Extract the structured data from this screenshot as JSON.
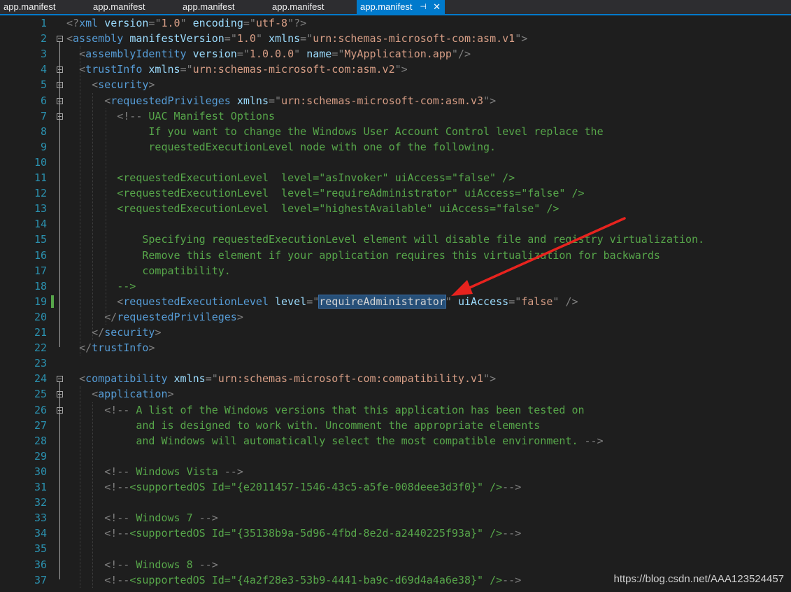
{
  "tabs": [
    {
      "label": "app.manifest",
      "active": false
    },
    {
      "label": "app.manifest",
      "active": false
    },
    {
      "label": "app.manifest",
      "active": false
    },
    {
      "label": "app.manifest",
      "active": false
    },
    {
      "label": "app.manifest",
      "active": true,
      "pin_icon": "pin-icon",
      "close_icon": "close-icon"
    }
  ],
  "colors": {
    "background": "#1e1e1e",
    "line_number": "#2b91af",
    "element": "#569cd6",
    "attribute": "#9cdcfe",
    "value": "#d69d85",
    "comment": "#57a64a",
    "active_tab": "#007acc",
    "selection": "#264f78",
    "arrow": "#e8231e"
  },
  "editor": {
    "selected_text": "requireAdministrator",
    "modified_line": 19,
    "lines": [
      {
        "n": "1",
        "fold": false,
        "tokens": [
          [
            "b",
            "<?"
          ],
          [
            "e",
            "xml"
          ],
          [
            "p",
            " "
          ],
          [
            "a",
            "version"
          ],
          [
            "b",
            "="
          ],
          [
            "b",
            "\""
          ],
          [
            "v",
            "1.0"
          ],
          [
            "b",
            "\""
          ],
          [
            "p",
            " "
          ],
          [
            "a",
            "encoding"
          ],
          [
            "b",
            "="
          ],
          [
            "b",
            "\""
          ],
          [
            "v",
            "utf-8"
          ],
          [
            "b",
            "\""
          ],
          [
            "b",
            "?>"
          ]
        ]
      },
      {
        "n": "2",
        "fold": true,
        "tokens": [
          [
            "b",
            "<"
          ],
          [
            "e",
            "assembly"
          ],
          [
            "p",
            " "
          ],
          [
            "a",
            "manifestVersion"
          ],
          [
            "b",
            "="
          ],
          [
            "b",
            "\""
          ],
          [
            "v",
            "1.0"
          ],
          [
            "b",
            "\""
          ],
          [
            "p",
            " "
          ],
          [
            "a",
            "xmlns"
          ],
          [
            "b",
            "="
          ],
          [
            "b",
            "\""
          ],
          [
            "v",
            "urn:schemas-microsoft-com:asm.v1"
          ],
          [
            "b",
            "\""
          ],
          [
            "b",
            ">"
          ]
        ]
      },
      {
        "n": "3",
        "fold": false,
        "tokens": [
          [
            "p",
            "  "
          ],
          [
            "b",
            "<"
          ],
          [
            "e",
            "assemblyIdentity"
          ],
          [
            "p",
            " "
          ],
          [
            "a",
            "version"
          ],
          [
            "b",
            "="
          ],
          [
            "b",
            "\""
          ],
          [
            "v",
            "1.0.0.0"
          ],
          [
            "b",
            "\""
          ],
          [
            "p",
            " "
          ],
          [
            "a",
            "name"
          ],
          [
            "b",
            "="
          ],
          [
            "b",
            "\""
          ],
          [
            "v",
            "MyApplication.app"
          ],
          [
            "b",
            "\""
          ],
          [
            "b",
            "/>"
          ]
        ]
      },
      {
        "n": "4",
        "fold": true,
        "tokens": [
          [
            "p",
            "  "
          ],
          [
            "b",
            "<"
          ],
          [
            "e",
            "trustInfo"
          ],
          [
            "p",
            " "
          ],
          [
            "a",
            "xmlns"
          ],
          [
            "b",
            "="
          ],
          [
            "b",
            "\""
          ],
          [
            "v",
            "urn:schemas-microsoft-com:asm.v2"
          ],
          [
            "b",
            "\""
          ],
          [
            "b",
            ">"
          ]
        ]
      },
      {
        "n": "5",
        "fold": true,
        "tokens": [
          [
            "p",
            "    "
          ],
          [
            "b",
            "<"
          ],
          [
            "e",
            "security"
          ],
          [
            "b",
            ">"
          ]
        ]
      },
      {
        "n": "6",
        "fold": true,
        "tokens": [
          [
            "p",
            "      "
          ],
          [
            "b",
            "<"
          ],
          [
            "e",
            "requestedPrivileges"
          ],
          [
            "p",
            " "
          ],
          [
            "a",
            "xmlns"
          ],
          [
            "b",
            "="
          ],
          [
            "b",
            "\""
          ],
          [
            "v",
            "urn:schemas-microsoft-com:asm.v3"
          ],
          [
            "b",
            "\""
          ],
          [
            "b",
            ">"
          ]
        ]
      },
      {
        "n": "7",
        "fold": true,
        "tokens": [
          [
            "p",
            "        "
          ],
          [
            "b",
            "<!--"
          ],
          [
            "c",
            " UAC Manifest Options"
          ]
        ]
      },
      {
        "n": "8",
        "fold": false,
        "tokens": [
          [
            "c",
            "             If you want to change the Windows User Account Control level replace the"
          ]
        ]
      },
      {
        "n": "9",
        "fold": false,
        "tokens": [
          [
            "c",
            "             requestedExecutionLevel node with one of the following."
          ]
        ]
      },
      {
        "n": "10",
        "fold": false,
        "tokens": []
      },
      {
        "n": "11",
        "fold": false,
        "tokens": [
          [
            "c",
            "        <requestedExecutionLevel  level=\"asInvoker\" uiAccess=\"false\" />"
          ]
        ]
      },
      {
        "n": "12",
        "fold": false,
        "tokens": [
          [
            "c",
            "        <requestedExecutionLevel  level=\"requireAdministrator\" uiAccess=\"false\" />"
          ]
        ]
      },
      {
        "n": "13",
        "fold": false,
        "tokens": [
          [
            "c",
            "        <requestedExecutionLevel  level=\"highestAvailable\" uiAccess=\"false\" />"
          ]
        ]
      },
      {
        "n": "14",
        "fold": false,
        "tokens": []
      },
      {
        "n": "15",
        "fold": false,
        "tokens": [
          [
            "c",
            "            Specifying requestedExecutionLevel element will disable file and registry virtualization."
          ]
        ]
      },
      {
        "n": "16",
        "fold": false,
        "tokens": [
          [
            "c",
            "            Remove this element if your application requires this virtualization for backwards"
          ]
        ]
      },
      {
        "n": "17",
        "fold": false,
        "tokens": [
          [
            "c",
            "            compatibility."
          ]
        ]
      },
      {
        "n": "18",
        "fold": false,
        "tokens": [
          [
            "c",
            "        -->"
          ]
        ]
      },
      {
        "n": "19",
        "fold": false,
        "tokens": [
          [
            "p",
            "        "
          ],
          [
            "b",
            "<"
          ],
          [
            "e",
            "requestedExecutionLevel"
          ],
          [
            "p",
            " "
          ],
          [
            "a",
            "level"
          ],
          [
            "b",
            "="
          ],
          [
            "b",
            "\""
          ],
          [
            "sel",
            "requireAdministrator"
          ],
          [
            "b",
            "\""
          ],
          [
            "p",
            " "
          ],
          [
            "a",
            "uiAccess"
          ],
          [
            "b",
            "="
          ],
          [
            "b",
            "\""
          ],
          [
            "v",
            "false"
          ],
          [
            "b",
            "\""
          ],
          [
            "p",
            " "
          ],
          [
            "b",
            "/>"
          ]
        ]
      },
      {
        "n": "20",
        "fold": false,
        "tokens": [
          [
            "p",
            "      "
          ],
          [
            "b",
            "</"
          ],
          [
            "e",
            "requestedPrivileges"
          ],
          [
            "b",
            ">"
          ]
        ]
      },
      {
        "n": "21",
        "fold": false,
        "tokens": [
          [
            "p",
            "    "
          ],
          [
            "b",
            "</"
          ],
          [
            "e",
            "security"
          ],
          [
            "b",
            ">"
          ]
        ]
      },
      {
        "n": "22",
        "fold": false,
        "tokens": [
          [
            "p",
            "  "
          ],
          [
            "b",
            "</"
          ],
          [
            "e",
            "trustInfo"
          ],
          [
            "b",
            ">"
          ]
        ]
      },
      {
        "n": "23",
        "fold": false,
        "tokens": []
      },
      {
        "n": "24",
        "fold": true,
        "tokens": [
          [
            "p",
            "  "
          ],
          [
            "b",
            "<"
          ],
          [
            "e",
            "compatibility"
          ],
          [
            "p",
            " "
          ],
          [
            "a",
            "xmlns"
          ],
          [
            "b",
            "="
          ],
          [
            "b",
            "\""
          ],
          [
            "v",
            "urn:schemas-microsoft-com:compatibility.v1"
          ],
          [
            "b",
            "\""
          ],
          [
            "b",
            ">"
          ]
        ]
      },
      {
        "n": "25",
        "fold": true,
        "tokens": [
          [
            "p",
            "    "
          ],
          [
            "b",
            "<"
          ],
          [
            "e",
            "application"
          ],
          [
            "b",
            ">"
          ]
        ]
      },
      {
        "n": "26",
        "fold": true,
        "tokens": [
          [
            "p",
            "      "
          ],
          [
            "b",
            "<!--"
          ],
          [
            "c",
            " A list of the Windows versions that this application has been tested on"
          ]
        ]
      },
      {
        "n": "27",
        "fold": false,
        "tokens": [
          [
            "c",
            "           and is designed to work with. Uncomment the appropriate elements"
          ]
        ]
      },
      {
        "n": "28",
        "fold": false,
        "tokens": [
          [
            "c",
            "           and Windows will automatically select the most compatible environment. "
          ],
          [
            "b",
            "-->"
          ]
        ]
      },
      {
        "n": "29",
        "fold": false,
        "tokens": []
      },
      {
        "n": "30",
        "fold": false,
        "tokens": [
          [
            "p",
            "      "
          ],
          [
            "b",
            "<!--"
          ],
          [
            "c",
            " Windows Vista "
          ],
          [
            "b",
            "-->"
          ]
        ]
      },
      {
        "n": "31",
        "fold": false,
        "tokens": [
          [
            "p",
            "      "
          ],
          [
            "b",
            "<!--"
          ],
          [
            "c",
            "<supportedOS Id=\"{e2011457-1546-43c5-a5fe-008deee3d3f0}\" />"
          ],
          [
            "b",
            "-->"
          ]
        ]
      },
      {
        "n": "32",
        "fold": false,
        "tokens": []
      },
      {
        "n": "33",
        "fold": false,
        "tokens": [
          [
            "p",
            "      "
          ],
          [
            "b",
            "<!--"
          ],
          [
            "c",
            " Windows 7 "
          ],
          [
            "b",
            "-->"
          ]
        ]
      },
      {
        "n": "34",
        "fold": false,
        "tokens": [
          [
            "p",
            "      "
          ],
          [
            "b",
            "<!--"
          ],
          [
            "c",
            "<supportedOS Id=\"{35138b9a-5d96-4fbd-8e2d-a2440225f93a}\" />"
          ],
          [
            "b",
            "-->"
          ]
        ]
      },
      {
        "n": "35",
        "fold": false,
        "tokens": []
      },
      {
        "n": "36",
        "fold": false,
        "tokens": [
          [
            "p",
            "      "
          ],
          [
            "b",
            "<!--"
          ],
          [
            "c",
            " Windows 8 "
          ],
          [
            "b",
            "-->"
          ]
        ]
      },
      {
        "n": "37",
        "fold": false,
        "tokens": [
          [
            "p",
            "      "
          ],
          [
            "b",
            "<!--"
          ],
          [
            "c",
            "<supportedOS Id=\"{4a2f28e3-53b9-4441-ba9c-d69d4a4a6e38}\" />"
          ],
          [
            "b",
            "-->"
          ]
        ]
      }
    ]
  },
  "watermark": "https://blog.csdn.net/AAA123524457"
}
